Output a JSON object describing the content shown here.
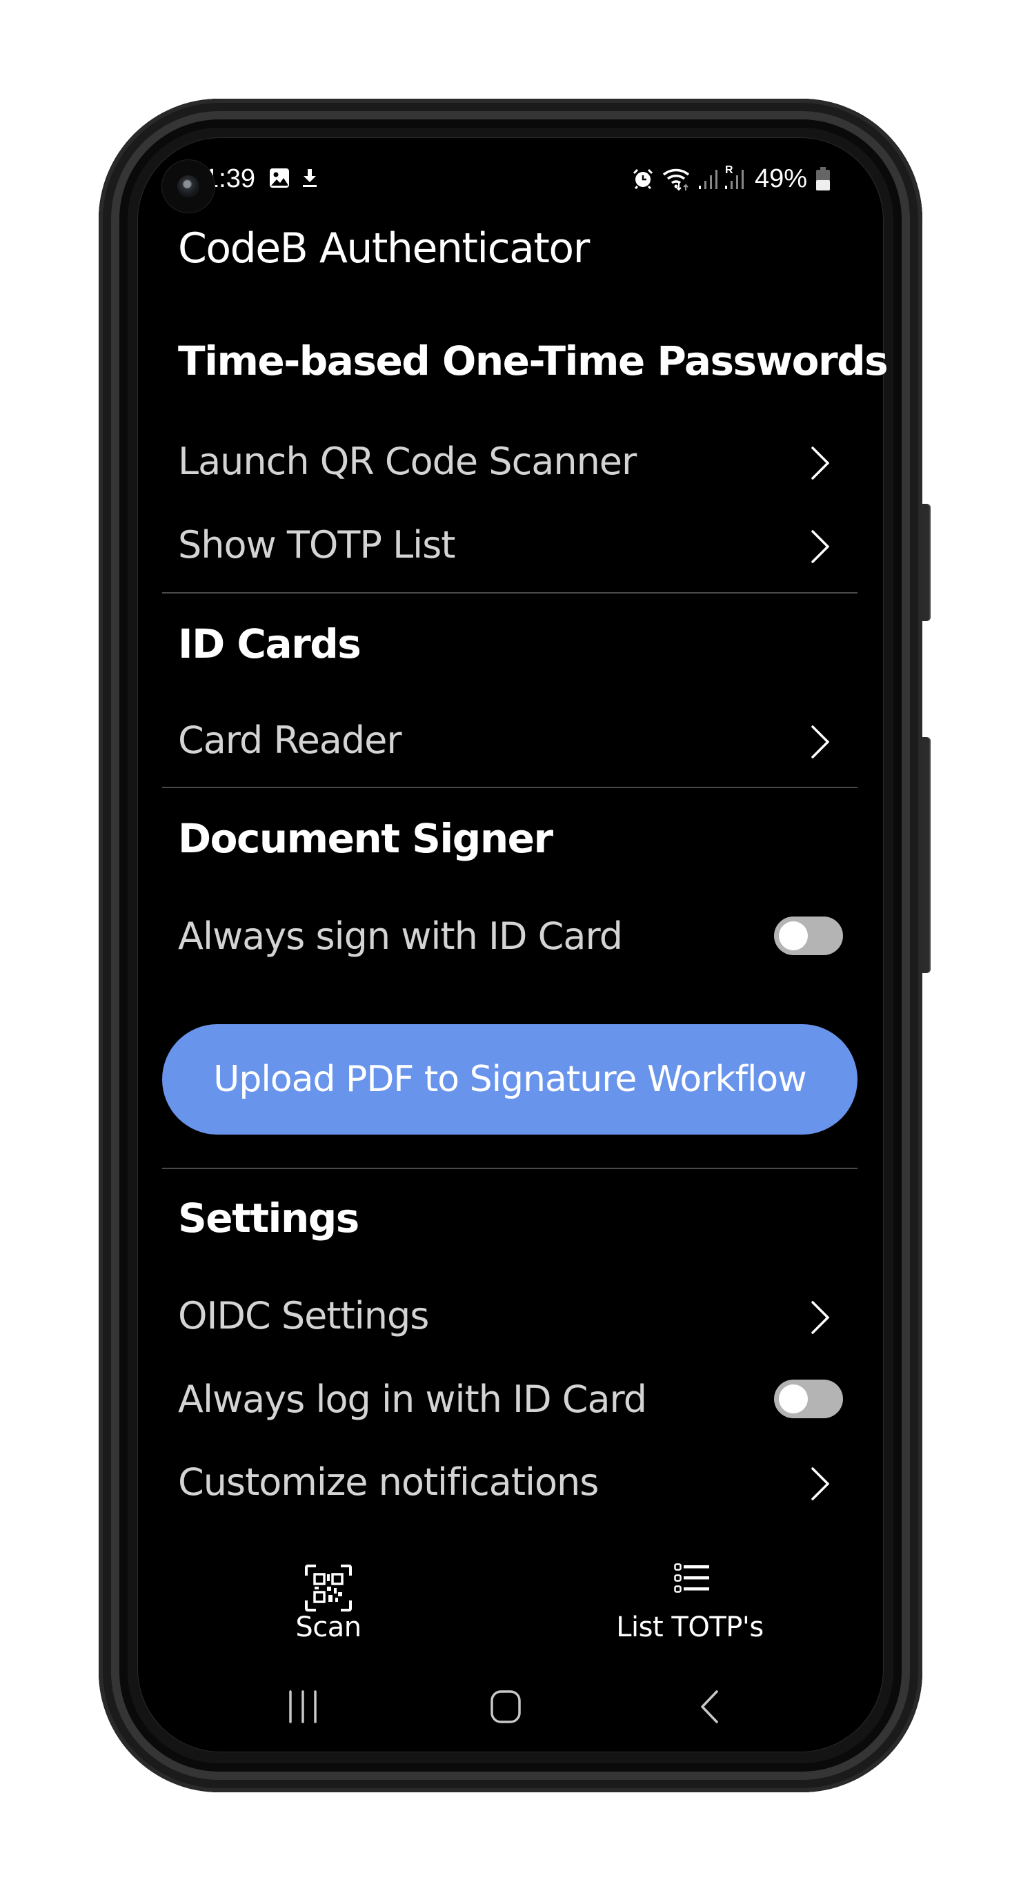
{
  "status_bar": {
    "time": "1:39",
    "left_icons": [
      "image-notification-icon",
      "download-icon"
    ],
    "right_icons": [
      "alarm-icon",
      "wifi-icon",
      "cell-signal-icon",
      "roaming-signal-icon",
      "battery-icon"
    ],
    "roaming_label": "R",
    "battery_percent": "49%",
    "battery_level": 0.49
  },
  "app": {
    "title": "CodeB Authenticator"
  },
  "sections": {
    "totp": {
      "header": "Time-based One-Time Passwords",
      "items": [
        {
          "label": "Launch QR Code Scanner",
          "icon": "chevron-right-icon"
        },
        {
          "label": "Show TOTP List",
          "icon": "chevron-right-icon"
        }
      ]
    },
    "id_cards": {
      "header": "ID Cards",
      "items": [
        {
          "label": "Card Reader",
          "icon": "chevron-right-icon"
        }
      ]
    },
    "document_signer": {
      "header": "Document Signer",
      "toggle": {
        "label": "Always sign with ID Card",
        "checked": false
      },
      "button_label": "Upload PDF to Signature Workflow"
    },
    "settings": {
      "header": "Settings",
      "items": [
        {
          "label": "OIDC Settings",
          "icon": "chevron-right-icon"
        },
        {
          "label": "Always log in with ID Card",
          "type": "toggle",
          "checked": false
        },
        {
          "label": "Customize notifications",
          "icon": "chevron-right-icon"
        }
      ]
    }
  },
  "bottom_nav": {
    "items": [
      {
        "label": "Scan",
        "icon": "qr-scan-icon"
      },
      {
        "label": "List TOTP's",
        "icon": "list-icon"
      }
    ]
  },
  "system_nav": {
    "buttons": [
      "recent-apps",
      "home",
      "back"
    ]
  },
  "colors": {
    "background": "#000000",
    "accent_button": "#6894ec",
    "toggle_track_off": "#b4b4b4",
    "item_text": "#d4d4d4",
    "header_text": "#ffffff",
    "divider": "#4a4a4a"
  }
}
